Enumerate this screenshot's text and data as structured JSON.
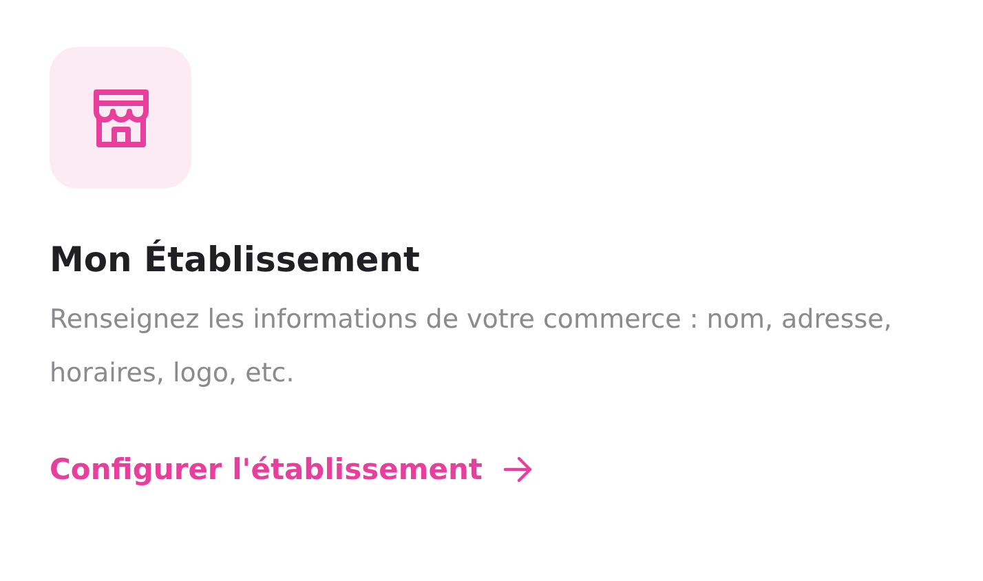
{
  "card": {
    "title": "Mon Établissement",
    "description": "Renseignez les informations de votre commerce : nom, adresse, horaires, logo, etc.",
    "link": {
      "label": "Configurer l'établissement"
    }
  }
}
